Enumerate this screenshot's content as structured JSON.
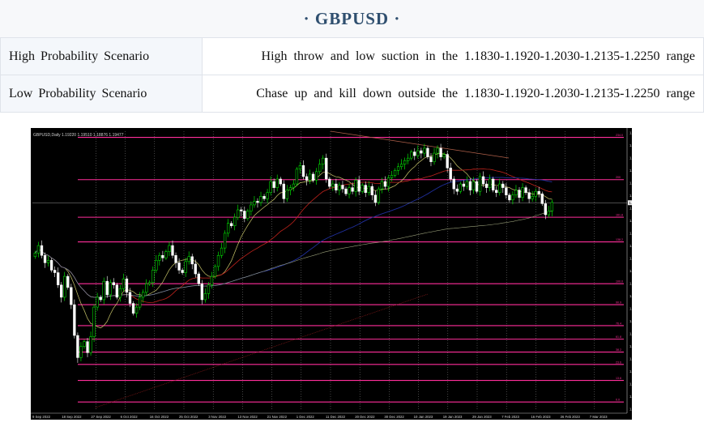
{
  "page": {
    "title": "· GBPUSD ·"
  },
  "scenarios": [
    {
      "label": "High Probability Scenario",
      "value": "High throw and low suction in the 1.1830-1.1920-1.2030-1.2135-1.2250 range"
    },
    {
      "label": "Low Probability Scenario",
      "value": "Chase up and kill down outside the 1.1830-1.1920-1.2030-1.2135-1.2250 range"
    }
  ],
  "chart": {
    "header_text": "GBPUSD,Daily  1.19220 1.19510 1.18876 1.19477",
    "price_tag": "1.19477",
    "colors": {
      "background": "#000000",
      "bull": "#00ff00",
      "bear": "#ffffff",
      "level": "#ff2e9a",
      "grid": "#8a8a8a"
    }
  },
  "chart_data": {
    "type": "candlestick",
    "symbol": "GBPUSD",
    "timeframe": "Daily",
    "ylim": [
      1.0285,
      1.2528
    ],
    "y_tick_labels": [
      "1.25280",
      "1.24380",
      "1.23340",
      "1.22320",
      "1.21300",
      "1.20250",
      "1.19230",
      "1.18210",
      "1.17190",
      "1.16150",
      "1.15150",
      "1.14100",
      "1.13080",
      "1.12060",
      "1.11040",
      "1.10020",
      "1.09000",
      "1.07950",
      "1.06930",
      "1.05910",
      "1.04890",
      "1.03870",
      "1.02850"
    ],
    "x_tick_labels": [
      "9 Sep 2022",
      "18 Sep 2022",
      "27 Sep 2022",
      "6 Oct 2022",
      "16 Oct 2022",
      "25 Oct 2022",
      "3 Nov 2022",
      "13 Nov 2022",
      "21 Nov 2022",
      "1 Dec 2022",
      "11 Dec 2022",
      "20 Dec 2022",
      "30 Dec 2022",
      "10 Jan 2023",
      "19 Jan 2023",
      "29 Jan 2023",
      "7 Feb 2023",
      "16 Feb 2023",
      "26 Feb 2023",
      "7 Mar 2023"
    ],
    "fibonacci_levels": [
      {
        "price": 1.2478,
        "label": "234.0"
      },
      {
        "price": 1.2135,
        "label": "200"
      },
      {
        "price": 1.183,
        "label": "161.8"
      },
      {
        "price": 1.163,
        "label": "138.2"
      },
      {
        "price": 1.129,
        "label": "100.0"
      },
      {
        "price": 1.112,
        "label": "90.9"
      },
      {
        "price": 1.095,
        "label": "76.4"
      },
      {
        "price": 1.084,
        "label": "61.8"
      },
      {
        "price": 1.0735,
        "label": "38.2"
      },
      {
        "price": 1.0635,
        "label": "23.6"
      },
      {
        "price": 1.0505,
        "label": "13.6"
      },
      {
        "price": 1.033,
        "label": "0.0"
      }
    ],
    "current_price": 1.19477,
    "closes": [
      1.154,
      1.16,
      1.152,
      1.146,
      1.148,
      1.14,
      1.138,
      1.128,
      1.118,
      1.135,
      1.126,
      1.112,
      1.087,
      1.069,
      1.078,
      1.082,
      1.073,
      1.086,
      1.11,
      1.118,
      1.116,
      1.131,
      1.12,
      1.13,
      1.128,
      1.118,
      1.125,
      1.133,
      1.122,
      1.113,
      1.105,
      1.11,
      1.118,
      1.122,
      1.129,
      1.13,
      1.14,
      1.148,
      1.152,
      1.15,
      1.155,
      1.16,
      1.152,
      1.146,
      1.14,
      1.138,
      1.147,
      1.151,
      1.145,
      1.137,
      1.129,
      1.116,
      1.121,
      1.128,
      1.135,
      1.143,
      1.152,
      1.158,
      1.17,
      1.178,
      1.176,
      1.183,
      1.189,
      1.188,
      1.182,
      1.188,
      1.193,
      1.196,
      1.195,
      1.2,
      1.198,
      1.203,
      1.212,
      1.207,
      1.214,
      1.21,
      1.198,
      1.205,
      1.207,
      1.21,
      1.222,
      1.225,
      1.216,
      1.213,
      1.218,
      1.213,
      1.22,
      1.226,
      1.231,
      1.214,
      1.208,
      1.21,
      1.205,
      1.209,
      1.206,
      1.202,
      1.207,
      1.204,
      1.213,
      1.204,
      1.209,
      1.203,
      1.208,
      1.201,
      1.195,
      1.206,
      1.212,
      1.208,
      1.215,
      1.217,
      1.221,
      1.224,
      1.226,
      1.229,
      1.231,
      1.236,
      1.233,
      1.237,
      1.235,
      1.239,
      1.232,
      1.228,
      1.235,
      1.239,
      1.232,
      1.234,
      1.223,
      1.214,
      1.206,
      1.204,
      1.21,
      1.208,
      1.212,
      1.205,
      1.212,
      1.204,
      1.216,
      1.21,
      1.207,
      1.214,
      1.205,
      1.203,
      1.21,
      1.207,
      1.201,
      1.197,
      1.201,
      1.205,
      1.199,
      1.207,
      1.203,
      1.198,
      1.2,
      1.204,
      1.202,
      1.194,
      1.185,
      1.188,
      1.195
    ]
  }
}
